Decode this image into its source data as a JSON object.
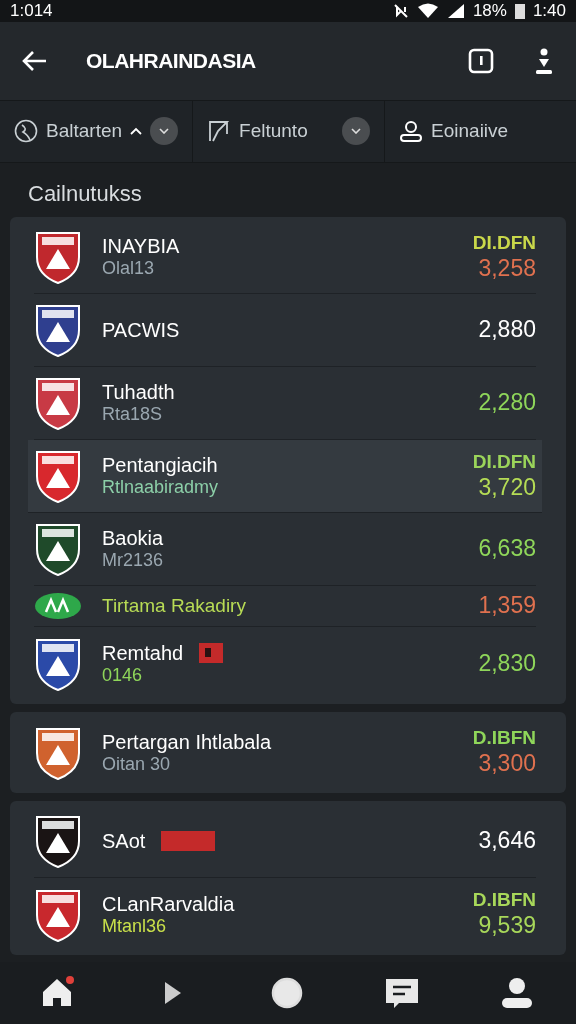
{
  "status_bar": {
    "time": "1:014",
    "battery": "18%",
    "clock": "1:40"
  },
  "app_bar": {
    "title": "OLAHRAINDASIA"
  },
  "filters": [
    {
      "label": "Baltarten",
      "caret": true,
      "action": true
    },
    {
      "label": "Feltunto",
      "caret": false,
      "action": true
    },
    {
      "label": "Eoinaiive",
      "caret": false,
      "action": false
    }
  ],
  "section_title": "Cailnutukss",
  "groups": [
    {
      "rows": [
        {
          "kind": "team",
          "name": "INAYBIA",
          "sub": "Olal13",
          "label": "DI.DFN",
          "score": "3,258",
          "color": "#e0714f",
          "highlighted": false
        },
        {
          "kind": "team",
          "name": "PACWIS",
          "score": "2,880",
          "color": "#ffffff",
          "highlighted": false
        },
        {
          "kind": "team",
          "name": "Tuhadth",
          "sub": "Rta18S",
          "score": "2,280",
          "color": "#8fd65a",
          "highlighted": false
        },
        {
          "kind": "team",
          "name": "Pentangiacih",
          "sub": "Rtlnaabiradmy",
          "label": "DI.DFN",
          "score": "3,720",
          "color": "#b5dc55",
          "highlighted": true
        },
        {
          "kind": "team",
          "name": "Baokia",
          "sub": "Mr2136",
          "score": "6,638",
          "color": "#8fd65a",
          "highlighted": false
        },
        {
          "kind": "sub",
          "name": "Tirtama Rakadiry",
          "score": "1,359",
          "color": "#e0714f",
          "highlighted": false
        },
        {
          "kind": "team",
          "name": "Remtahd",
          "tag": {
            "kind": "flag"
          },
          "sub": "0146",
          "score": "2,830",
          "color": "#8fd65a",
          "highlighted": false
        }
      ]
    },
    {
      "rows": [
        {
          "kind": "team",
          "name": "Pertargan Ihtlabala",
          "sub": "Oitan 30",
          "label": "D.IBFN",
          "score": "3,300",
          "color": "#e0714f",
          "highlighted": false
        }
      ]
    },
    {
      "rows": [
        {
          "kind": "team",
          "name": "SAot",
          "tag": {
            "kind": "bar"
          },
          "score": "3,646",
          "color": "#ffffff",
          "highlighted": false
        },
        {
          "kind": "team",
          "name": "CLanRarvaldia",
          "sub": "Mtanl36",
          "label": "D.IBFN",
          "score": "9,539",
          "color": "#a8d85a",
          "highlighted": false
        }
      ]
    }
  ],
  "bottom_nav": [
    {
      "kind": "home",
      "badge": true
    },
    {
      "kind": "play",
      "badge": false
    },
    {
      "kind": "circle",
      "badge": false
    },
    {
      "kind": "card",
      "badge": false
    },
    {
      "kind": "person",
      "badge": false
    }
  ]
}
